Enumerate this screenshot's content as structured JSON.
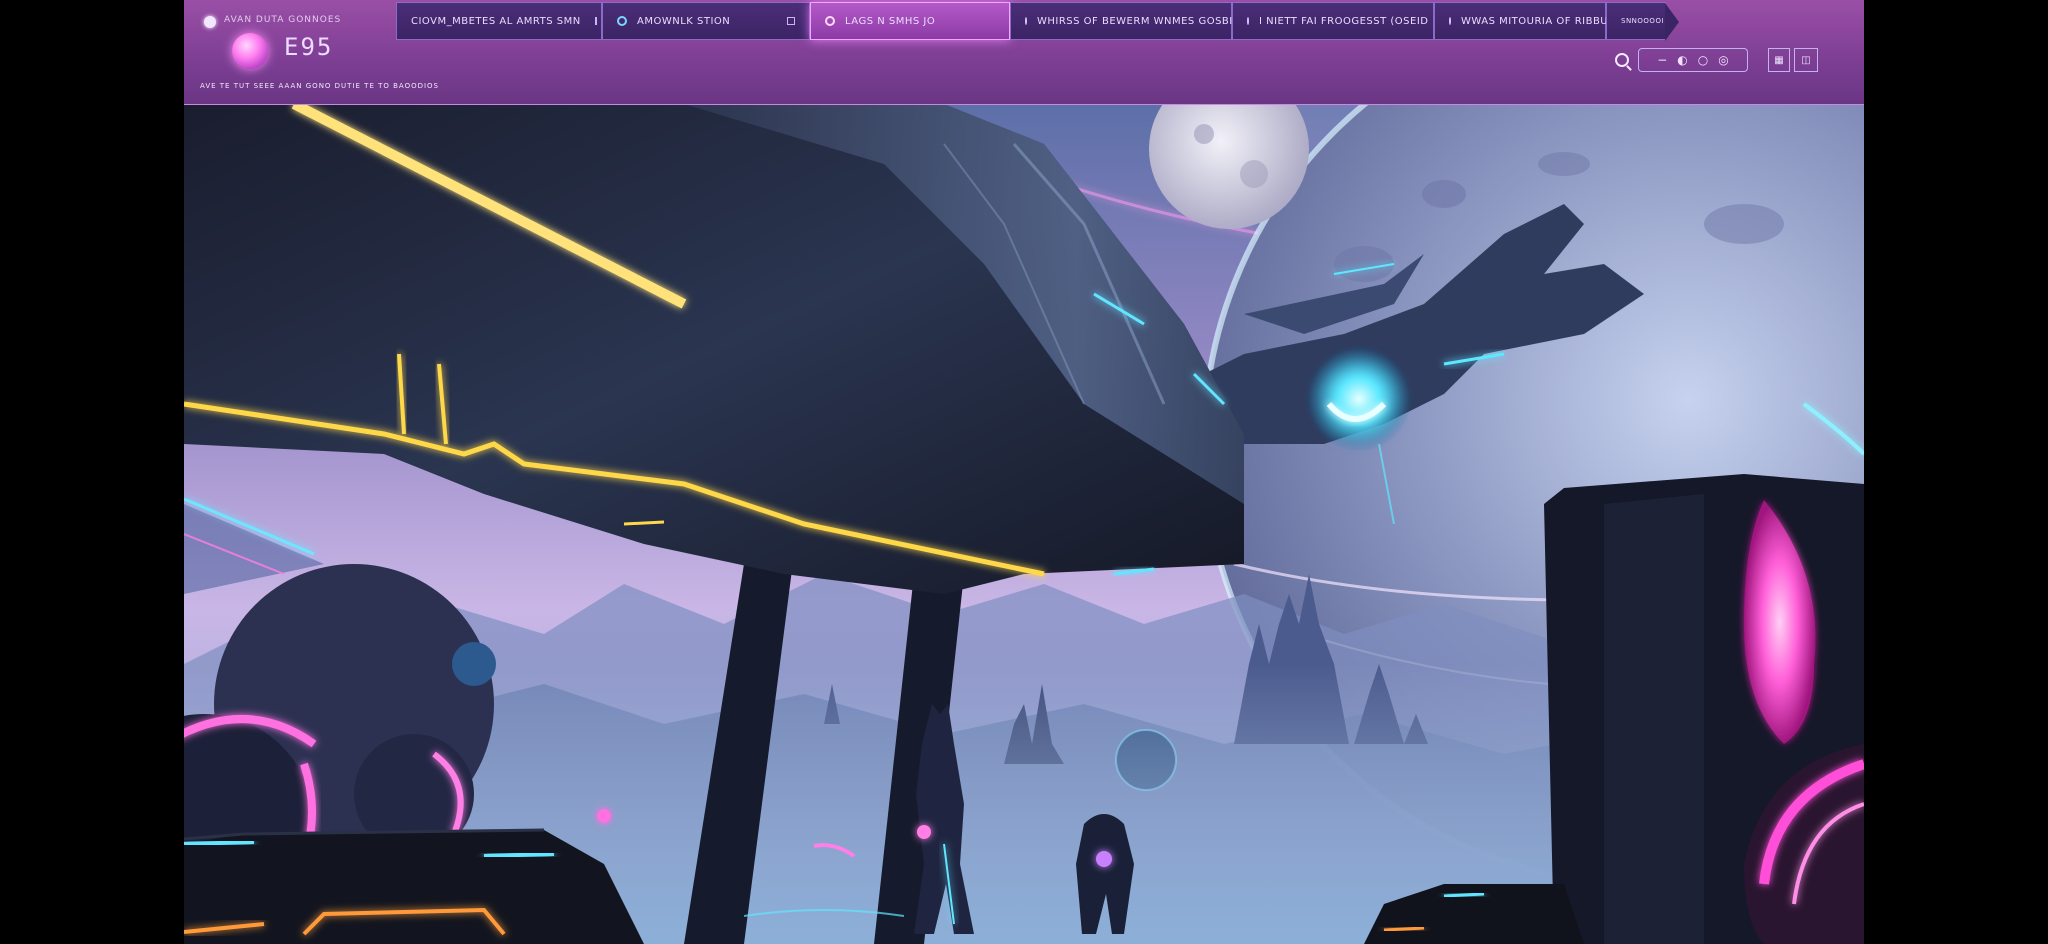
{
  "hud": {
    "brand_label": "AVAN DUTA GONNOES",
    "score": "E95",
    "subtitle": "AVE TE TUT SEEE AAAN GONO DUTIE TE TO BAOODIOS",
    "tabs": [
      {
        "label": "CIOVM_MBETES AL AMRTS SMN",
        "active": false
      },
      {
        "label": "AMOWNLK STION",
        "active": false
      },
      {
        "label": "LAGS N SMHS JO",
        "active": true
      },
      {
        "label": "WHIRSS OF BEWERM WNMES GOSBITTE",
        "active": false
      },
      {
        "label": "I NIETT FAI FROOGESST (OSEID",
        "active": false
      },
      {
        "label": "WWAS MITOURIA OF RIBBUT",
        "active": false
      },
      {
        "label": "SNNOOOOI",
        "active": false
      }
    ]
  },
  "tools": {
    "search_icon": "search-icon",
    "items": [
      "minus-icon",
      "gauge-icon",
      "settings-icon",
      "target-icon",
      "grid-icon",
      "panel-icon"
    ]
  },
  "colors": {
    "hud_bg": "#8c46a0",
    "tab_active": "#b45ac8",
    "neon_yellow": "#ffd84a",
    "neon_cyan": "#62e6ff",
    "neon_pink": "#ff4fd8"
  }
}
